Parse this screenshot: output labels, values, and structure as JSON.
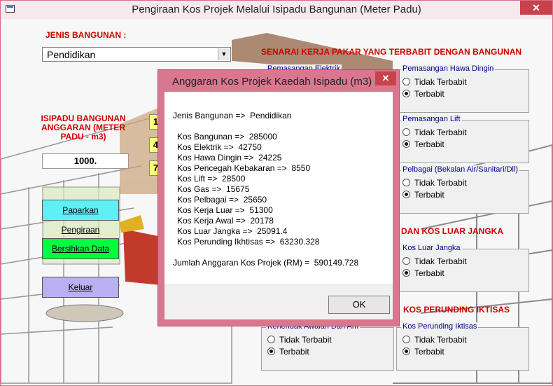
{
  "window": {
    "title": "Pengiraan Kos Projek Melalui Isipadu Bangunan  (Meter Padu)",
    "close_glyph": "✕"
  },
  "form": {
    "jenis_label": "JENIS BANGUNAN :",
    "jenis_value": "Pendidikan",
    "isipadu_label_1": "ISIPADU BANGUNAN",
    "isipadu_label_2": "ANGGARAN (METER",
    "isipadu_label_3": "PADU - m3)",
    "isipadu_value": "1000.",
    "yellow_boxes": [
      "1",
      "4",
      "7"
    ],
    "buttons": {
      "paparkan": "Paparkan Pengiraan",
      "bersihkan": "Bersihkan Data",
      "keluar": "Keluar"
    },
    "colors": {
      "paparkan": "#5ff0f5",
      "bersihkan": "#00ff40",
      "keluar": "#b8b0f0"
    }
  },
  "right_panel": {
    "senarai_heading": "SENARAI KERJA PAKAR YANG TERBABIT DENGAN BANGUNAN",
    "kos_luar_heading": "DAN KOS LUAR JANGKA",
    "perunding_heading": "KOS PERUNDING IKTISAS",
    "groups": {
      "elektrik": "Pemasangan Elektrik",
      "hawa_dingin": "Pemasangan Hawa Dingin",
      "lift": "Pemasangan Lift",
      "pelbagai": "Pelbagai (Bekalan Air/Sanitari/Dll)",
      "luar_jangka": "Kos Luar Jangka",
      "kerja_awal": "Kerlendak Awalan Dari Am",
      "perunding": "Kos Perunding Iktisas"
    },
    "opt_tidak": "Tidak Terbabit",
    "opt_terbabit": "Terbabit"
  },
  "dialog": {
    "title": "Anggaran Kos Projek Kaedah Isipadu (m3)",
    "close_glyph": "✕",
    "jenis": "Jenis Bangunan =>  Pendidikan",
    "lines": [
      "Kos Bangunan =>  285000",
      "Kos Elektrik =>  42750",
      "Kos Hawa Dingin =>  24225",
      "Kos Pencegah Kebakaran =>  8550",
      "Kos Lift =>  28500",
      "Kos Gas =>  15675",
      "Kos Pelbagai =>  25650",
      "Kos Kerja Luar =>  51300",
      "Kos Kerja Awal =>  20178",
      "Kos Luar Jangka =>  25091.4",
      "Kos Perunding Ikhtisas =>  63230.328"
    ],
    "total": "Jumlah Anggaran Kos Projek (RM) =  590149.728",
    "ok": "OK"
  }
}
